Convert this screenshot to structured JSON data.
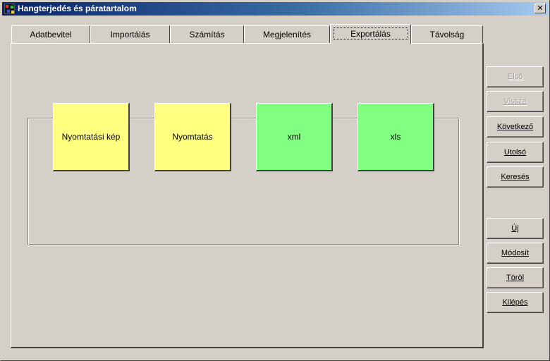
{
  "window": {
    "title": "Hangterjedés és páratartalom",
    "close_glyph": "✕"
  },
  "tabs": [
    {
      "label": "Adatbevitel",
      "active": false
    },
    {
      "label": "Importálás",
      "active": false
    },
    {
      "label": "Számítás",
      "active": false
    },
    {
      "label": "Megjelenítés",
      "active": false
    },
    {
      "label": "Exportálás",
      "active": true
    },
    {
      "label": "Távolság",
      "active": false
    }
  ],
  "export_panel": {
    "tiles": [
      {
        "label": "Nyomtatási kép",
        "color": "#ffff80"
      },
      {
        "label": "Nyomtatás",
        "color": "#ffff80"
      },
      {
        "label": "xml",
        "color": "#80ff80"
      },
      {
        "label": "xls",
        "color": "#80ff80"
      }
    ]
  },
  "nav_buttons": [
    {
      "label": "Első",
      "enabled": false
    },
    {
      "label": "Vissza",
      "enabled": false
    },
    {
      "label": "Következő",
      "enabled": true
    },
    {
      "label": "Utolsó",
      "enabled": true
    },
    {
      "label": "Keresés",
      "enabled": true
    }
  ],
  "record_buttons": [
    {
      "label": "Új",
      "enabled": true
    },
    {
      "label": "Módosít",
      "enabled": true
    },
    {
      "label": "Töröl",
      "enabled": true
    },
    {
      "label": "Kilépés",
      "enabled": true
    }
  ],
  "colors": {
    "title_gradient_start": "#0a246a",
    "title_gradient_end": "#a6caf0",
    "face": "#d4d0c8",
    "tile_yellow": "#ffff80",
    "tile_green": "#80ff80"
  }
}
